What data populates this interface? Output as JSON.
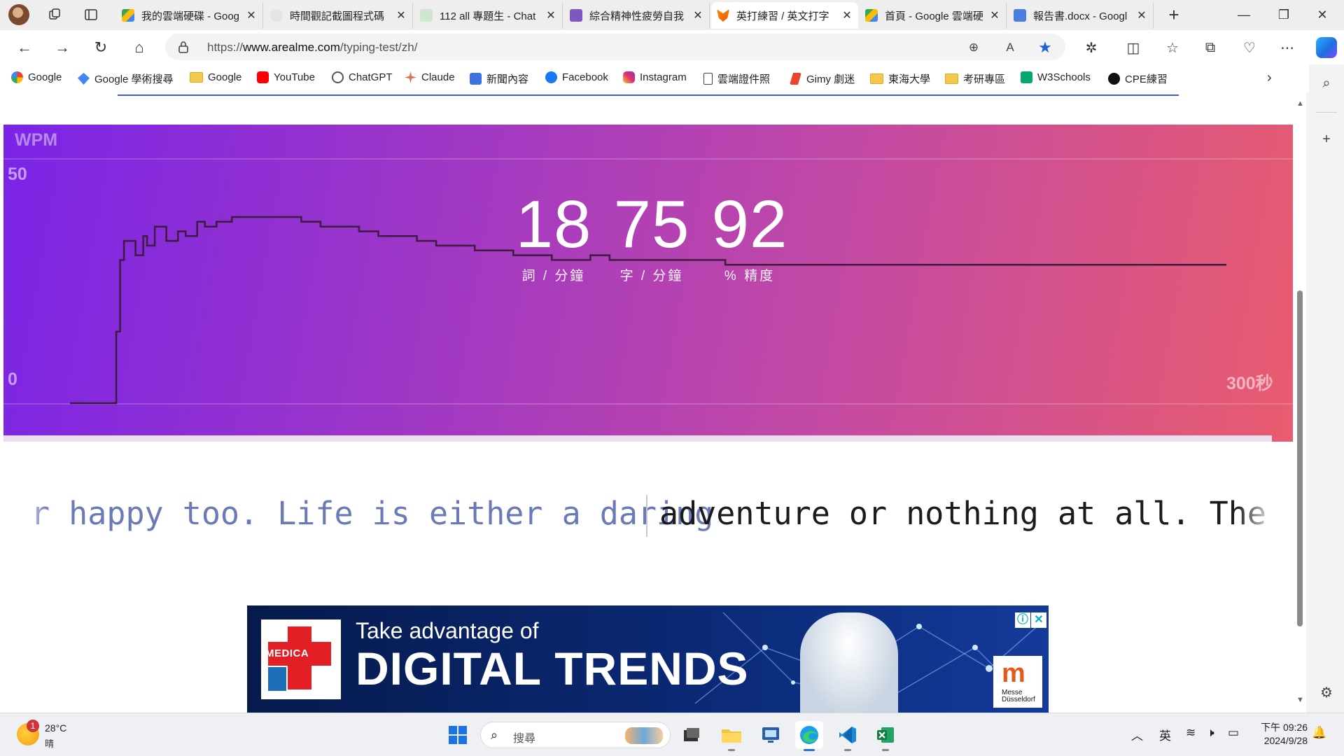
{
  "tabs": [
    {
      "title": "我的雲端硬碟 - Goog",
      "active": false
    },
    {
      "title": "時間觀記截圖程式碼",
      "active": false
    },
    {
      "title": "112 all 專題生 - Chat",
      "active": false
    },
    {
      "title": "綜合精神性疲勞自我",
      "active": false
    },
    {
      "title": "英打練習 / 英文打字",
      "active": true
    },
    {
      "title": "首頁 - Google 雲端硬",
      "active": false
    },
    {
      "title": "報告書.docx - Googl",
      "active": false
    }
  ],
  "address": {
    "prefix": "https://",
    "host": "www.arealme.com",
    "path": "/typing-test/zh/"
  },
  "bookmarks": [
    {
      "label": "Google"
    },
    {
      "label": "Google 學術搜尋"
    },
    {
      "label": "Google"
    },
    {
      "label": "YouTube"
    },
    {
      "label": "ChatGPT"
    },
    {
      "label": "Claude"
    },
    {
      "label": "新聞內容"
    },
    {
      "label": "Facebook"
    },
    {
      "label": "Instagram"
    },
    {
      "label": "雲端證件照"
    },
    {
      "label": "Gimy 劇迷"
    },
    {
      "label": "東海大學"
    },
    {
      "label": "考研專區"
    },
    {
      "label": "W3Schools"
    },
    {
      "label": "CPE練習"
    }
  ],
  "graph": {
    "label": "WPM",
    "y_max_label": "50",
    "y_min_label": "0",
    "x_end_label": "300秒"
  },
  "stats": [
    {
      "value": "18",
      "label": "詞 / 分鐘"
    },
    {
      "value": "75",
      "label": "字 / 分鐘"
    },
    {
      "value": "92",
      "label": "% 精度"
    }
  ],
  "typing": {
    "typed": "r happy too. Life is either a daring",
    "untyped": "adventure or nothing at all. The gr"
  },
  "ad": {
    "logo_text": "MEDICA",
    "line1": "Take advantage of",
    "line2": "DIGITAL TRENDS",
    "badge_text": "Messe Düsseldorf"
  },
  "taskbar": {
    "weather_temp": "28°C",
    "weather_desc": "晴",
    "weather_badge": "1",
    "search_placeholder": "搜尋",
    "ime": "英",
    "time": "下午 09:26",
    "date": "2024/9/28"
  },
  "chart_data": {
    "type": "line",
    "title": "WPM",
    "xlabel": "",
    "ylabel": "",
    "xlim": [
      0,
      300
    ],
    "ylim": [
      0,
      50
    ],
    "x_tick_labels": [
      "0",
      "300秒"
    ],
    "y_tick_labels": [
      "0",
      "50"
    ],
    "series": [
      {
        "x": [
          0,
          10,
          12,
          13,
          14,
          17,
          19,
          20,
          22,
          25,
          28,
          30,
          33,
          35,
          38,
          42,
          46,
          50,
          55,
          60,
          65,
          70,
          75,
          80,
          85,
          90,
          95,
          100,
          105,
          110,
          115,
          120,
          125,
          130,
          135,
          140,
          145,
          150,
          160,
          170,
          180,
          190,
          200,
          210,
          220,
          230,
          240,
          250,
          260,
          270,
          280,
          290,
          300
        ],
        "y": [
          0,
          0,
          15,
          30,
          34,
          31,
          35,
          33,
          37,
          34,
          36,
          35,
          38,
          37,
          38,
          39,
          39,
          39,
          39,
          38,
          37,
          37,
          36,
          35,
          35,
          34,
          33,
          33,
          32,
          32,
          31,
          31,
          30,
          30,
          31,
          30,
          30,
          30,
          30,
          29,
          29,
          29,
          29,
          29,
          29,
          29,
          29,
          29,
          29,
          29,
          29,
          29,
          29
        ]
      }
    ]
  }
}
